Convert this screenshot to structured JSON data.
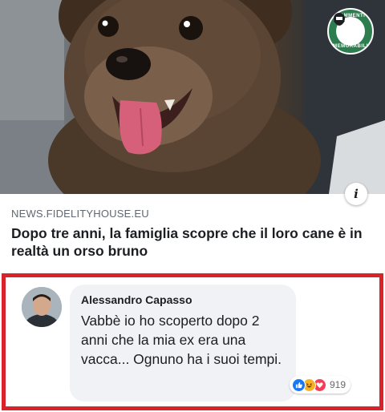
{
  "post": {
    "link_domain": "NEWS.FIDELITYHOUSE.EU",
    "link_headline": "Dopo tre anni, la famiglia scopre che il loro cane è in realtà un orso bruno",
    "info_glyph": "i",
    "badge": {
      "top_text": "COMMENTI",
      "bottom_text": "MEMORABILI",
      "brand_color": "#2e7d4f"
    },
    "photo_icon": "bear-cub-photo"
  },
  "comment": {
    "author": "Alessandro Capasso",
    "text": "Vabbè io ho scoperto dopo 2 anni che la mia ex era una vacca... Ognuno ha i suoi tempi.",
    "reactions": {
      "icons": [
        "like-icon",
        "haha-icon",
        "love-icon"
      ],
      "count": "919"
    },
    "highlight_color": "#d8232a"
  }
}
